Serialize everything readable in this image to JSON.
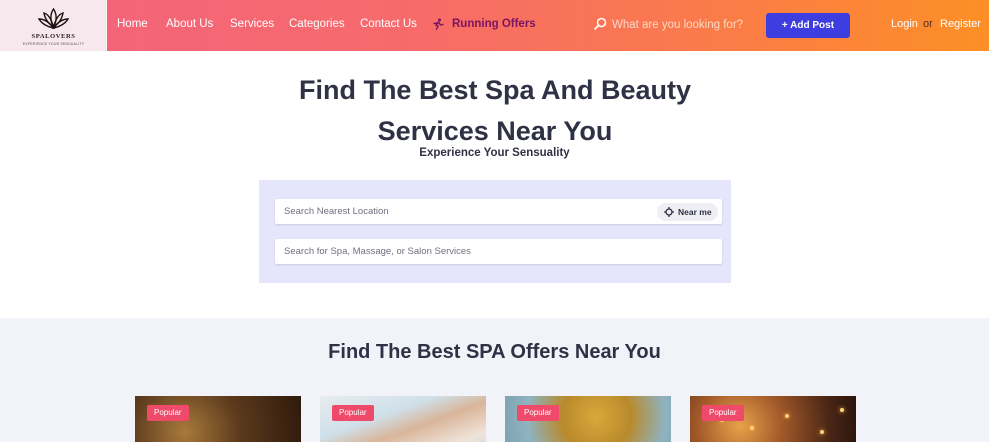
{
  "brand": {
    "name": "SPALOVERS",
    "tagline": "EXPERIENCE YOUR SENSUALITY"
  },
  "nav": {
    "home": "Home",
    "about": "About Us",
    "services": "Services",
    "categories": "Categories",
    "contact": "Contact Us",
    "offers": "Running Offers"
  },
  "header_search": {
    "placeholder": "What are you looking for?"
  },
  "actions": {
    "add_post": "+ Add Post",
    "login": "Login",
    "or": "or",
    "register": "Register"
  },
  "hero": {
    "title": "Find The Best Spa And Beauty Services Near You",
    "subtitle": "Experience Your Sensuality",
    "location_placeholder": "Search Nearest Location",
    "near_me": "Near me",
    "service_placeholder": "Search for Spa, Massage, or Salon Services"
  },
  "offers_section": {
    "title": "Find The Best SPA Offers Near You",
    "cards": [
      {
        "badge": "Popular"
      },
      {
        "badge": "Popular"
      },
      {
        "badge": "Popular"
      },
      {
        "badge": "Popular"
      }
    ]
  },
  "colors": {
    "header_start": "#f2637e",
    "header_end": "#fd8f25",
    "add_post_bg": "#3d3de0",
    "offers_text": "#7a1460",
    "badge_bg": "#ef4a6a",
    "search_panel_bg": "#e5e5fb"
  },
  "icons": {
    "offers": "running-person-icon",
    "search": "search-icon",
    "near_me": "crosshair-icon",
    "logo": "lotus-icon"
  }
}
